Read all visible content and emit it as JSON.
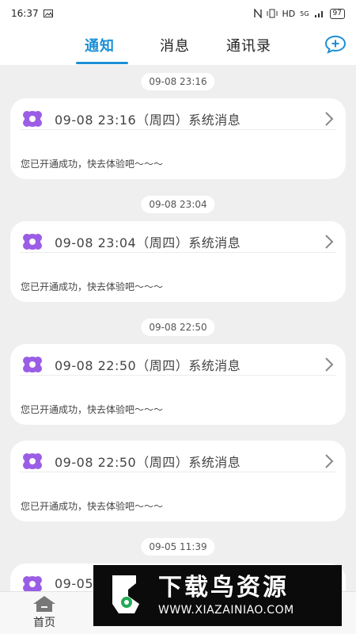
{
  "status_bar": {
    "time": "16:37",
    "network": "HD",
    "signal": "5G",
    "battery": "97"
  },
  "header": {
    "tabs": [
      {
        "label": "通知",
        "active": true
      },
      {
        "label": "消息",
        "active": false
      },
      {
        "label": "通讯录",
        "active": false
      }
    ],
    "accent": "#1a8fd6"
  },
  "feed": {
    "time_pills": [
      "09-08 23:16",
      "09-08 23:04",
      "09-08 22:50",
      "09-05 11:39"
    ],
    "cards": [
      {
        "title": "09-08 23:16（周四）系统消息",
        "body": "您已开通成功，快去体验吧～～～"
      },
      {
        "title": "09-08 23:04（周四）系统消息",
        "body": "您已开通成功，快去体验吧～～～"
      },
      {
        "title": "09-08 22:50（周四）系统消息",
        "body": "您已开通成功，快去体验吧～～～"
      },
      {
        "title": "09-08 22:50（周四）系统消息",
        "body": "您已开通成功，快去体验吧～～～"
      },
      {
        "title": "09-05",
        "body": ""
      }
    ],
    "icon_color": "#9b5de5"
  },
  "bottom_nav": {
    "items": [
      {
        "label": "首页",
        "icon": "home-icon"
      }
    ]
  },
  "watermark": {
    "line1": "下载鸟资源",
    "line2": "WWW.XIAZAINIAO.COM"
  }
}
